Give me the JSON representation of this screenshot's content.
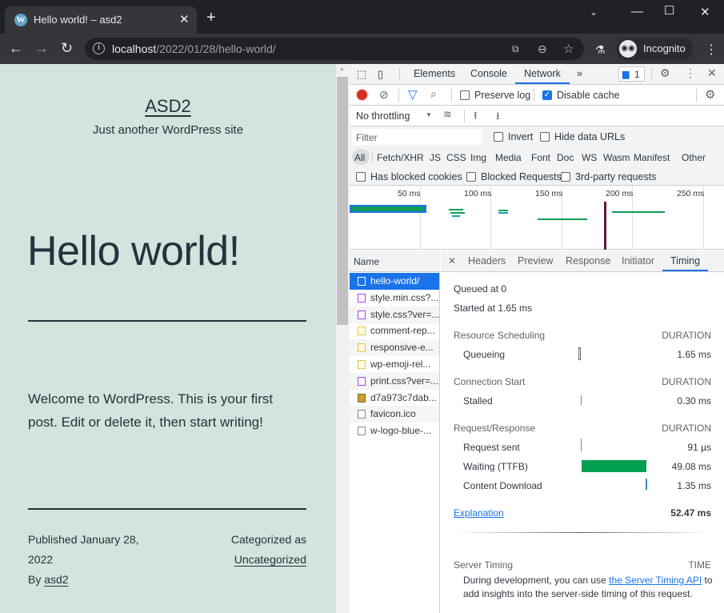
{
  "browser": {
    "tab_title": "Hello world! – asd2",
    "tab_favicon": "wordpress-icon",
    "url_host": "localhost",
    "url_path": "/2022/01/28/hello-world/",
    "profile_label": "Incognito",
    "icons": [
      "back-icon",
      "forward-icon",
      "reload-icon",
      "info-icon",
      "translate-icon",
      "zoom-out-icon",
      "star-icon",
      "labs-icon",
      "incognito-icon",
      "menu-icon",
      "tab-search-icon",
      "minimize-icon",
      "maximize-icon",
      "close-icon",
      "new-tab-icon"
    ]
  },
  "page": {
    "site_title": "ASD2",
    "tagline": "Just another WordPress site",
    "post_title": "Hello world!",
    "content": "Welcome to WordPress. This is your first post. Edit or delete it, then start writing!",
    "published_prefix": "Published ",
    "published_date": "January 28, 2022",
    "by_prefix": "By ",
    "author": "asd2",
    "categorized_prefix": "Categorized as",
    "category": "Uncategorized",
    "bg_color": "#d1e4dd"
  },
  "devtools": {
    "tabs": [
      "Elements",
      "Console",
      "Network"
    ],
    "active_tab": "Network",
    "more_tabs": "»",
    "issues_count": "1",
    "preserve_log": {
      "label": "Preserve log",
      "checked": false
    },
    "disable_cache": {
      "label": "Disable cache",
      "checked": true
    },
    "throttling": "No throttling",
    "filter_placeholder": "Filter",
    "invert": {
      "label": "Invert",
      "checked": false
    },
    "hide_data_urls": {
      "label": "Hide data URLs",
      "checked": false
    },
    "type_filters": [
      "All",
      "Fetch/XHR",
      "JS",
      "CSS",
      "Img",
      "Media",
      "Font",
      "Doc",
      "WS",
      "Wasm",
      "Manifest",
      "Other"
    ],
    "active_type_filter": "All",
    "has_blocked_cookies": {
      "label": "Has blocked cookies",
      "checked": false
    },
    "blocked_requests": {
      "label": "Blocked Requests",
      "checked": false
    },
    "third_party": {
      "label": "3rd-party requests",
      "checked": false
    },
    "overview_ticks": [
      "50 ms",
      "100 ms",
      "150 ms",
      "200 ms",
      "250 ms"
    ],
    "name_header": "Name",
    "requests": [
      {
        "name": "hello-world/",
        "type": "doc",
        "selected": true
      },
      {
        "name": "style.min.css?...",
        "type": "css"
      },
      {
        "name": "style.css?ver=...",
        "type": "css"
      },
      {
        "name": "comment-rep...",
        "type": "js"
      },
      {
        "name": "responsive-e...",
        "type": "js"
      },
      {
        "name": "wp-emoji-rel...",
        "type": "js"
      },
      {
        "name": "print.css?ver=...",
        "type": "css"
      },
      {
        "name": "d7a973c7dab...",
        "type": "img"
      },
      {
        "name": "favicon.ico",
        "type": "other"
      },
      {
        "name": "w-logo-blue-...",
        "type": "other"
      }
    ],
    "detail_tabs": [
      "Headers",
      "Preview",
      "Response",
      "Initiator",
      "Timing"
    ],
    "active_detail_tab": "Timing",
    "timing": {
      "queued_at": "Queued at 0",
      "started_at": "Started at 1.65 ms",
      "duration_label": "DURATION",
      "sections": [
        {
          "title": "Resource Scheduling",
          "rows": [
            {
              "label": "Queueing",
              "value": "1.65 ms"
            }
          ]
        },
        {
          "title": "Connection Start",
          "rows": [
            {
              "label": "Stalled",
              "value": "0.30 ms"
            }
          ]
        },
        {
          "title": "Request/Response",
          "rows": [
            {
              "label": "Request sent",
              "value": "91 µs"
            },
            {
              "label": "Waiting (TTFB)",
              "value": "49.08 ms"
            },
            {
              "label": "Content Download",
              "value": "1.35 ms"
            }
          ]
        }
      ],
      "explanation_link": "Explanation",
      "total": "52.47 ms",
      "server_timing_title": "Server Timing",
      "time_label": "TIME",
      "server_timing_text_pre": "During development, you can use ",
      "server_timing_link": "the Server Timing API",
      "server_timing_text_post": " to add insights into the server-side timing of this request.",
      "colors": {
        "ttfb": "#00a050",
        "download": "#2f8fbe"
      }
    }
  }
}
